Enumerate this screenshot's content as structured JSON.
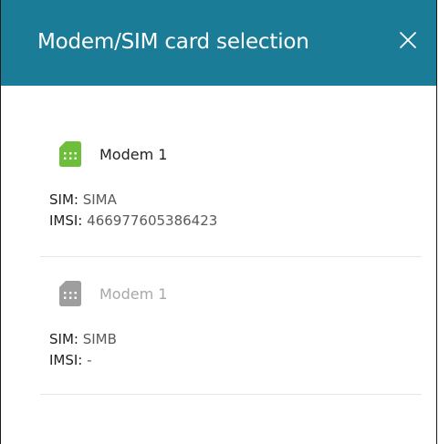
{
  "dialog": {
    "title": "Modem/SIM card selection",
    "close_icon": "close-icon"
  },
  "entries": [
    {
      "modem_label": "Modem 1",
      "sim_key": "SIM:",
      "sim_value": "SIMA",
      "imsi_key": "IMSI:",
      "imsi_value": "466977605386423",
      "icon": "sim-card-icon",
      "icon_color": "#6dbe3a",
      "active": true
    },
    {
      "modem_label": "Modem 1",
      "sim_key": "SIM:",
      "sim_value": "SIMB",
      "imsi_key": "IMSI:",
      "imsi_value": "-",
      "icon": "sim-card-icon",
      "icon_color": "#9e9e9e",
      "active": false
    }
  ],
  "colors": {
    "header_bg": "#1a7c97",
    "header_text": "#ffffff"
  }
}
